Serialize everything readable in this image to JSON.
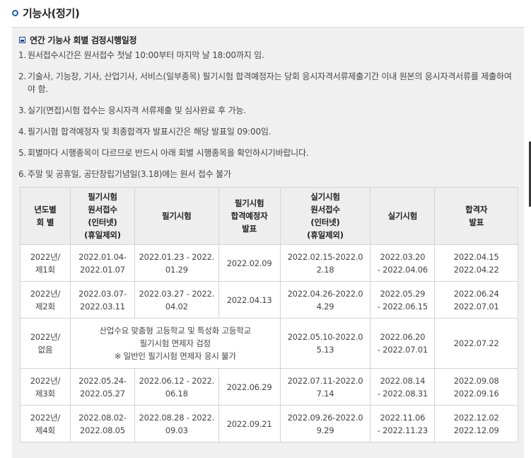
{
  "page": {
    "title": "기능사(정기)"
  },
  "section": {
    "title": "연간 기능사 회별 검정시행일정"
  },
  "notes": [
    {
      "num": "1.",
      "text": "원서접수시간은 원서접수 첫날 10:00부터 마지막 날 18:00까지 임."
    },
    {
      "num": "2.",
      "text": "기술사, 기능장, 기사, 산업기사, 서비스(일부종목) 필기시험 합격예정자는 당회 응시자격서류제출기간 이내 원본의 응시자격서류를 제출하여야 함."
    },
    {
      "num": "3.",
      "text": "실기(면접)시험 접수는 응시자격 서류제출 및 심사완료 후 가능."
    },
    {
      "num": "4.",
      "text": "필기시험 합격예정자 및 최종합격자 발표시간은 해당 발표일 09:00임."
    },
    {
      "num": "5.",
      "text": "회별마다 시행종목이 다르므로 반드시 아래 회별 시행종목을 확인하시기바랍니다."
    },
    {
      "num": "6.",
      "text": "주말 및 공휴일, 공단창립기념일(3.18)에는 원서 접수 불가"
    }
  ],
  "table": {
    "headers": [
      "년도별\n회 별",
      "필기시험\n원서접수\n(인터넷)\n(휴일제외)",
      "필기시험",
      "필기시험\n합격예정자\n발표",
      "실기시험\n원서접수\n(인터넷)\n(휴일제외)",
      "실기시험",
      "합격자\n발표"
    ],
    "rows": [
      {
        "round": "2022년/\n제1회",
        "written_apply": "2022.01.04-\n2022.01.07",
        "written_exam": "2022.01.23 - 2022.\n01.29",
        "written_result": "2022.02.09",
        "practical_apply": "2022.02.15-2022.0\n2.18",
        "practical_exam": "2022.03.20\n- 2022.04.06",
        "final_result": "2022.04.15\n2022.04.22"
      },
      {
        "round": "2022년/\n제2회",
        "written_apply": "2022.03.07-\n2022.03.11",
        "written_exam": "2022.03.27 - 2022.\n04.02",
        "written_result": "2022.04.13",
        "practical_apply": "2022.04.26-2022.0\n4.29",
        "practical_exam": "2022.05.29\n- 2022.06.15",
        "final_result": "2022.06.24\n2022.07.01"
      },
      {
        "round": "2022년/\n없음",
        "note": "산업수요 맞춤형 고등학교 및 특성화 고등학교\n필기시험 면제자 검정\n※ 일반인 필기시험 면제자 응시 불가",
        "practical_apply": "2022.05.10-2022.0\n5.13",
        "practical_exam": "2022.06.20\n- 2022.07.01",
        "final_result": "2022.07.22"
      },
      {
        "round": "2022년/\n제3회",
        "written_apply": "2022.05.24-\n2022.05.27",
        "written_exam": "2022.06.12 - 2022.\n06.18",
        "written_result": "2022.06.29",
        "practical_apply": "2022.07.11-2022.0\n7.14",
        "practical_exam": "2022.08.14\n- 2022.08.31",
        "final_result": "2022.09.08\n2022.09.16"
      },
      {
        "round": "2022년/\n제4회",
        "written_apply": "2022.08.02-\n2022.08.05",
        "written_exam": "2022.08.28 - 2022.\n09.03",
        "written_result": "2022.09.21",
        "practical_apply": "2022.09.26-2022.0\n9.29",
        "practical_exam": "2022.11.06\n- 2022.11.23",
        "final_result": "2022.12.02\n2022.12.09"
      }
    ]
  }
}
